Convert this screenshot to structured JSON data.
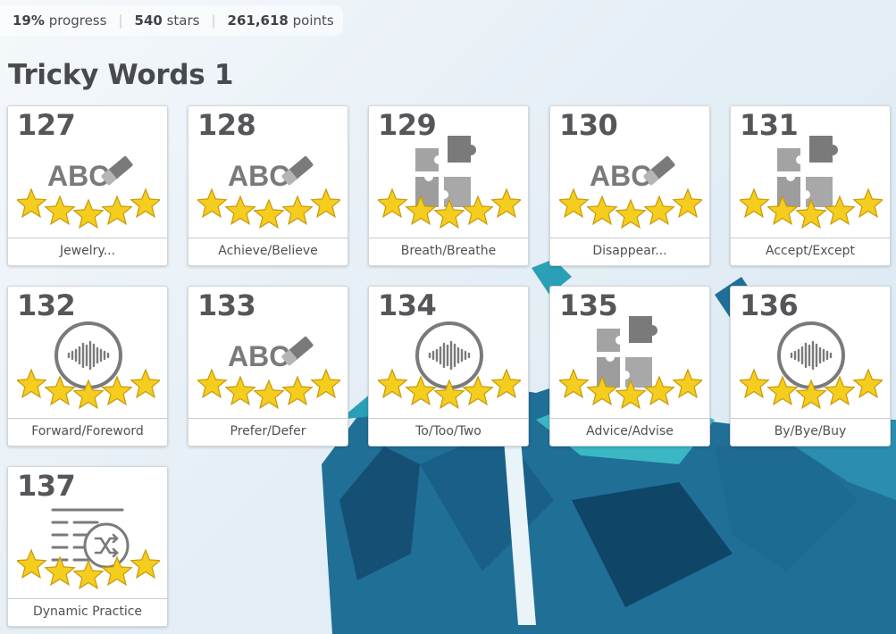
{
  "stats": {
    "progress_value": "19%",
    "progress_label": "progress",
    "stars_value": "540",
    "stars_label": "stars",
    "points_value": "261,618",
    "points_label": "points"
  },
  "section_title": "Tricky Words 1",
  "cards": [
    {
      "number": "127",
      "label": "Jewelry...",
      "icon": "eraser-abc-icon",
      "stars": 5
    },
    {
      "number": "128",
      "label": "Achieve/Believe",
      "icon": "eraser-abc-icon",
      "stars": 5
    },
    {
      "number": "129",
      "label": "Breath/Breathe",
      "icon": "puzzle-icon",
      "stars": 5
    },
    {
      "number": "130",
      "label": "Disappear...",
      "icon": "eraser-abc-icon",
      "stars": 5
    },
    {
      "number": "131",
      "label": "Accept/Except",
      "icon": "puzzle-icon",
      "stars": 5
    },
    {
      "number": "132",
      "label": "Forward/Foreword",
      "icon": "audio-wave-icon",
      "stars": 5
    },
    {
      "number": "133",
      "label": "Prefer/Defer",
      "icon": "eraser-abc-icon",
      "stars": 5
    },
    {
      "number": "134",
      "label": "To/Too/Two",
      "icon": "audio-wave-icon",
      "stars": 5
    },
    {
      "number": "135",
      "label": "Advice/Advise",
      "icon": "puzzle-icon",
      "stars": 5
    },
    {
      "number": "136",
      "label": "By/Bye/Buy",
      "icon": "audio-wave-icon",
      "stars": 5
    },
    {
      "number": "137",
      "label": "Dynamic Practice",
      "icon": "shuffle-list-icon",
      "stars": 5
    }
  ],
  "colors": {
    "star_fill": "#f4cd1f",
    "star_stroke": "#c99a06",
    "icon_gray": "#7a7a7a"
  }
}
